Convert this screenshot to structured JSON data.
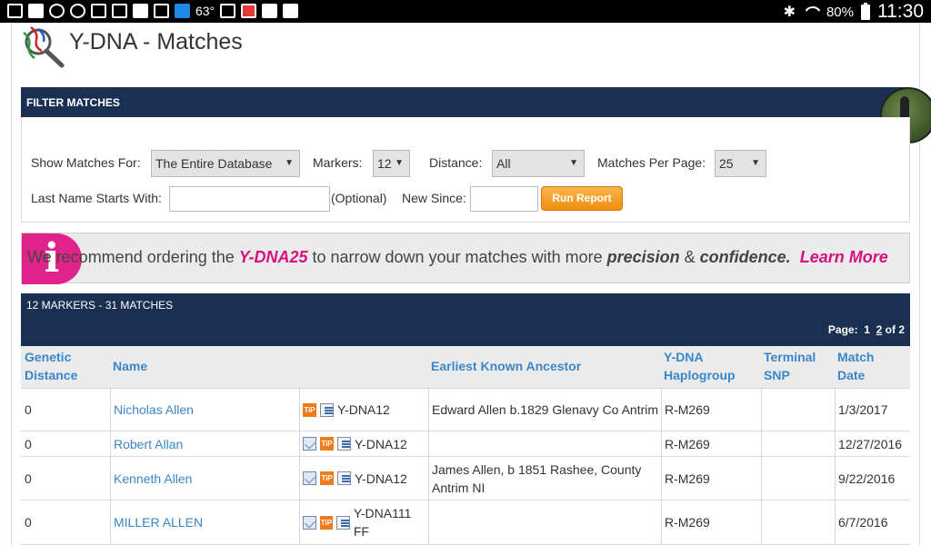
{
  "statusbar": {
    "weather_temp": "63°",
    "battery_pct": "80%",
    "time": "11:30"
  },
  "page": {
    "title": "Y-DNA - Matches"
  },
  "filter": {
    "header": "FILTER MATCHES",
    "show_matches_label": "Show Matches For:",
    "show_matches_value": "The Entire Database",
    "markers_label": "Markers:",
    "markers_value": "12",
    "distance_label": "Distance:",
    "distance_value": "All",
    "per_page_label": "Matches Per Page:",
    "per_page_value": "25",
    "last_name_label": "Last Name Starts With:",
    "last_name_value": "",
    "optional_note": "(Optional)",
    "new_since_label": "New Since:",
    "new_since_value": "",
    "run_button": "Run Report"
  },
  "banner": {
    "icon_letter": "i",
    "text_pre": "We recommend ordering the ",
    "product": "Y-DNA25",
    "text_mid": " to narrow down your matches with more ",
    "word1": "precision",
    "amp": " & ",
    "word2": "confidence.",
    "learn_more": "Learn More"
  },
  "results": {
    "summary": "12 MARKERS - 31 MATCHES",
    "page_label": "Page:",
    "page_1": "1",
    "page_2": "2",
    "page_of": "of 2"
  },
  "columns": {
    "distance": "Genetic Distance",
    "name": "Name",
    "ancestor": "Earliest Known Ancestor",
    "haplogroup": "Y-DNA Haplogroup",
    "snp": "Terminal SNP",
    "date": "Match Date"
  },
  "rows": [
    {
      "distance": "0",
      "name": "Nicholas Allen",
      "icons": [
        "tip",
        "notes"
      ],
      "test": "Y-DNA12",
      "ancestor": "Edward Allen b.1829 Glenavy Co Antrim",
      "haplogroup": "R-M269",
      "snp": "",
      "date": "1/3/2017"
    },
    {
      "distance": "0",
      "name": "Robert Allan",
      "icons": [
        "mail",
        "tip",
        "notes"
      ],
      "test": "Y-DNA12",
      "ancestor": "",
      "haplogroup": "R-M269",
      "snp": "",
      "date": "12/27/2016"
    },
    {
      "distance": "0",
      "name": "Kenneth Allen",
      "icons": [
        "mail",
        "tip",
        "notes"
      ],
      "test": "Y-DNA12",
      "ancestor": "James Allen, b 1851 Rashee, County Antrim NI",
      "haplogroup": "R-M269",
      "snp": "",
      "date": "9/22/2016"
    },
    {
      "distance": "0",
      "name": "MILLER ALLEN",
      "icons": [
        "mail",
        "tip",
        "notes"
      ],
      "test": "Y-DNA111 FF",
      "ancestor": "",
      "haplogroup": "R-M269",
      "snp": "",
      "date": "6/7/2016"
    }
  ],
  "icon_names": [
    "mail-icon",
    "tip-icon",
    "notes-icon",
    "dna-logo-icon",
    "info-icon"
  ]
}
